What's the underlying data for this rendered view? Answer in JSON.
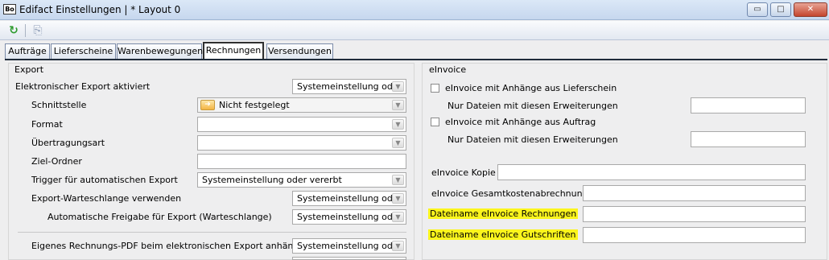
{
  "window": {
    "app_icon": "Bo",
    "title": "Edifact Einstellungen | * Layout 0",
    "minimize": "▭",
    "maximize": "□",
    "close": "✕"
  },
  "toolbar": {
    "refresh_icon": "↻",
    "copy_icon": "⎘"
  },
  "tabs": [
    {
      "label": "Aufträge"
    },
    {
      "label": "Lieferscheine"
    },
    {
      "label": "Warenbewegungen"
    },
    {
      "label": "Rechnungen"
    },
    {
      "label": "Versendungen"
    }
  ],
  "export": {
    "group_title": "Export",
    "elektronischer_export": {
      "label": "Elektronischer Export aktiviert",
      "value": "Systemeinstellung oder"
    },
    "schnittstelle": {
      "label": "Schnittstelle",
      "value": "Nicht festgelegt"
    },
    "format": {
      "label": "Format",
      "value": ""
    },
    "uebertragungsart": {
      "label": "Übertragungsart",
      "value": ""
    },
    "ziel_ordner": {
      "label": "Ziel-Ordner",
      "value": ""
    },
    "trigger": {
      "label": "Trigger für automatischen Export",
      "value": "Systemeinstellung oder vererbt"
    },
    "warteschlange": {
      "label": "Export-Warteschlange verwenden",
      "value": "Systemeinstellung oder"
    },
    "freigabe": {
      "label": "Automatische Freigabe für Export (Warteschlange)",
      "value": "Systemeinstellung oder"
    },
    "pdf_anhaengen": {
      "label": "Eigenes Rechnungs-PDF beim elektronischen Export anhängen",
      "value": "Systemeinstellung oder"
    }
  },
  "einvoice": {
    "group_title": "eInvoice",
    "anhang_lieferschein": {
      "label": "eInvoice mit Anhänge aus Lieferschein",
      "checked": false
    },
    "erweiterungen_1": {
      "label": "Nur Dateien mit diesen Erweiterungen",
      "value": ""
    },
    "anhang_auftrag": {
      "label": "eInvoice mit Anhänge aus Auftrag",
      "checked": false
    },
    "erweiterungen_2": {
      "label": "Nur Dateien mit diesen Erweiterungen",
      "value": ""
    },
    "kopie": {
      "label": "eInvoice Kopie",
      "value": ""
    },
    "gesamtkosten": {
      "label": "eInvoice Gesamtkostenabrechnung",
      "value": ""
    },
    "dateiname_rechnungen": {
      "label": "Dateiname eInvoice Rechnungen",
      "value": "",
      "highlight": "#fbf51d"
    },
    "dateiname_gutschriften": {
      "label": "Dateiname eInvoice Gutschriften",
      "value": "",
      "highlight": "#fbf51d"
    }
  }
}
